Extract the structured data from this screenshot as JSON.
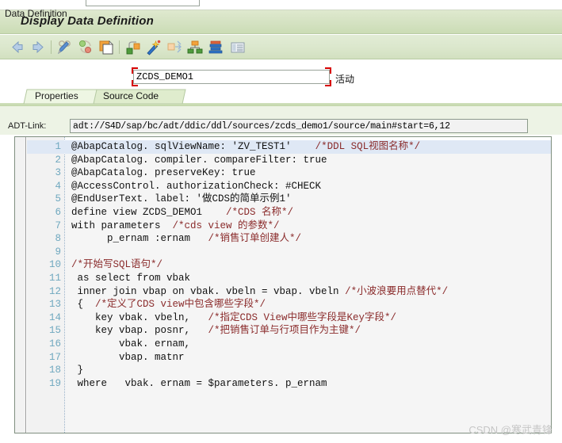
{
  "window": {
    "title": "Display Data Definition"
  },
  "toolbar": {
    "items": [
      {
        "name": "back-icon",
        "label": "Back"
      },
      {
        "name": "forward-icon",
        "label": "Forward"
      },
      {
        "name": "display-change-icon",
        "label": "Display <-> Change"
      },
      {
        "name": "activate-icon",
        "label": "Check"
      },
      {
        "name": "copy-icon",
        "label": "Other Object"
      },
      {
        "name": "where-used-icon",
        "label": "Where-Used List"
      },
      {
        "name": "activate-wand-icon",
        "label": "Activate"
      },
      {
        "name": "navigate-icon",
        "label": "Navigate"
      },
      {
        "name": "hierarchy-icon",
        "label": "Hierarchy"
      },
      {
        "name": "stack-icon",
        "label": "Data Preview"
      },
      {
        "name": "list-icon",
        "label": "Display List"
      }
    ]
  },
  "data_definition": {
    "label": "Data Definition",
    "value": "ZCDS_DEMO1",
    "placeholder": "",
    "status": "活动"
  },
  "tabs": [
    {
      "label": "Properties",
      "active": false
    },
    {
      "label": "Source Code",
      "active": true
    }
  ],
  "adt_link": {
    "label": "ADT-Link:",
    "value": "adt://S4D/sap/bc/adt/ddic/ddl/sources/zcds_demo1/source/main#start=6,12",
    "placeholder": ""
  },
  "editor": {
    "lines": [
      {
        "n": "1",
        "text": "@AbapCatalog. sqlViewName: 'ZV_TEST1'    /*DDL SQL视图名称*/",
        "highlighted": true
      },
      {
        "n": "2",
        "text": "@AbapCatalog. compiler. compareFilter: true",
        "highlighted": false
      },
      {
        "n": "3",
        "text": "@AbapCatalog. preserveKey: true",
        "highlighted": false
      },
      {
        "n": "4",
        "text": "@AccessControl. authorizationCheck: #CHECK",
        "highlighted": false
      },
      {
        "n": "5",
        "text": "@EndUserText. label: '做CDS的简单示例1'",
        "highlighted": false
      },
      {
        "n": "6",
        "text": "define view ZCDS_DEMO1    /*CDS 名称*/",
        "highlighted": false
      },
      {
        "n": "7",
        "text": "with parameters  /*cds view 的参数*/",
        "highlighted": false
      },
      {
        "n": "8",
        "text": "      p_ernam :ernam   /*销售订单创建人*/",
        "highlighted": false
      },
      {
        "n": "9",
        "text": "",
        "highlighted": false
      },
      {
        "n": "10",
        "text": "/*开始写SQL语句*/",
        "highlighted": false
      },
      {
        "n": "11",
        "text": " as select from vbak",
        "highlighted": false
      },
      {
        "n": "12",
        "text": " inner join vbap on vbak. vbeln = vbap. vbeln /*小波浪要用点替代*/",
        "highlighted": false
      },
      {
        "n": "13",
        "text": " {  /*定义了CDS view中包含哪些字段*/",
        "highlighted": false
      },
      {
        "n": "14",
        "text": "    key vbak. vbeln,   /*指定CDS View中哪些字段是Key字段*/",
        "highlighted": false
      },
      {
        "n": "15",
        "text": "    key vbap. posnr,   /*把销售订单与行项目作为主键*/",
        "highlighted": false
      },
      {
        "n": "16",
        "text": "        vbak. ernam,",
        "highlighted": false
      },
      {
        "n": "17",
        "text": "        vbap. matnr",
        "highlighted": false
      },
      {
        "n": "18",
        "text": " }",
        "highlighted": false
      },
      {
        "n": "19",
        "text": " where   vbak. ernam = $parameters. p_ernam",
        "highlighted": false
      }
    ]
  },
  "watermark": {
    "text": "CSDN @寒武青锋"
  },
  "colors": {
    "titlebar_green": "#d6e3c4",
    "toolbar_green": "#dbe7cc",
    "highlight_blue": "#dfe8f5",
    "line_number_blue": "#6fa8bf",
    "comment_red": "#8a2b2b",
    "required_red": "#d60000",
    "watermark_gray": "#c6c6c6"
  }
}
